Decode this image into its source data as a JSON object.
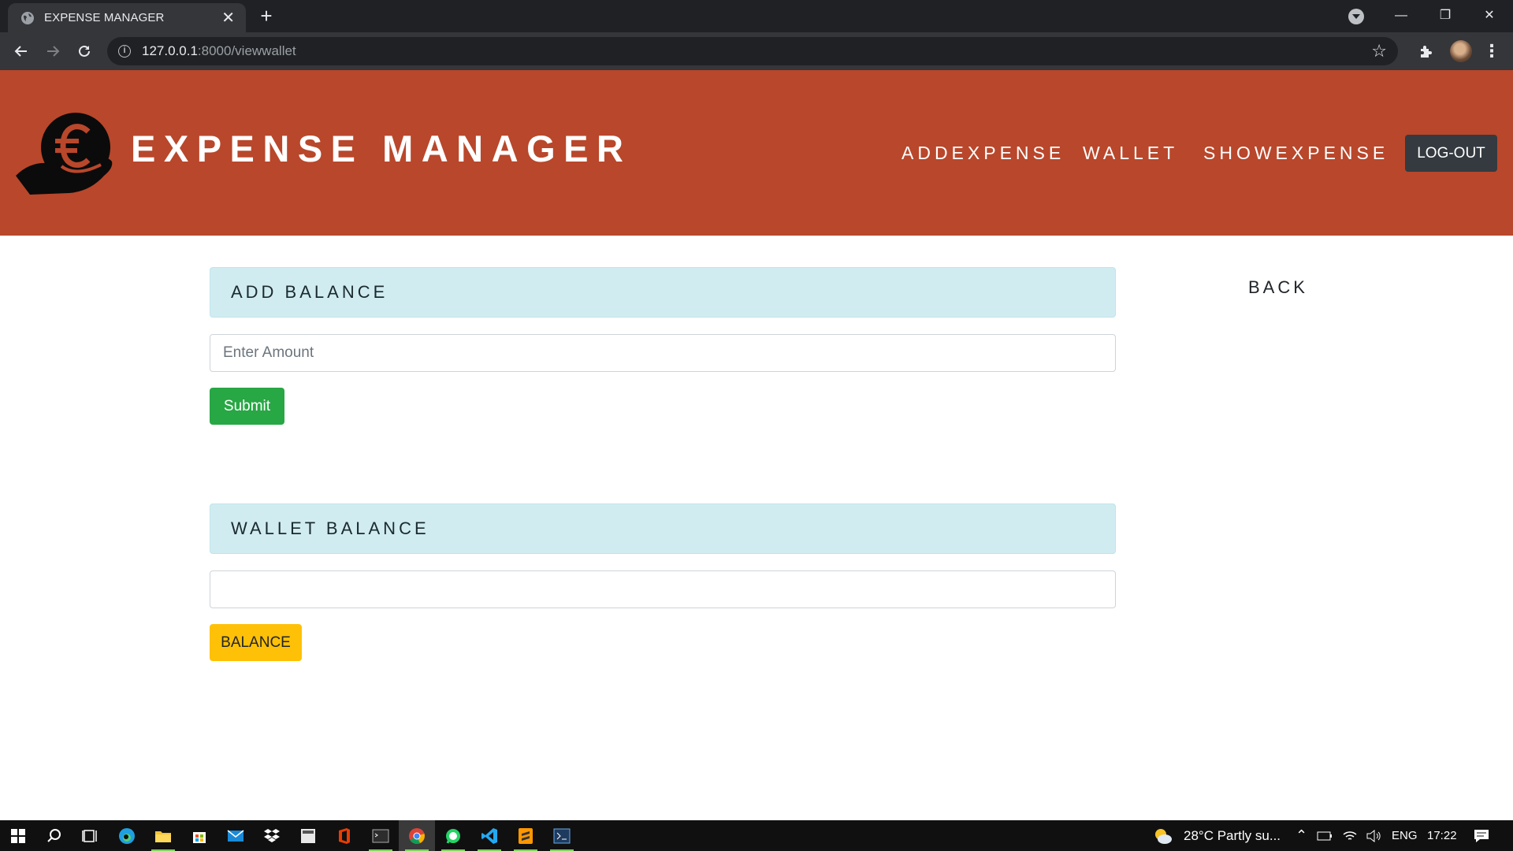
{
  "browser": {
    "tab_title": "EXPENSE MANAGER",
    "tab_close": "✕",
    "new_tab": "+",
    "url_host": "127.0.0.1",
    "url_path": ":8000/viewwallet",
    "window_controls": {
      "minimize": "—",
      "restore": "❐",
      "close": "✕"
    }
  },
  "header": {
    "brand": "EXPENSE MANAGER",
    "nav": [
      "ADDEXPENSE",
      "WALLET",
      "SHOWEXPENSE"
    ],
    "logout": "LOG-OUT"
  },
  "add_balance": {
    "heading": "ADD BALANCE",
    "amount_placeholder": "Enter Amount",
    "amount_value": "",
    "submit": "Submit"
  },
  "wallet_balance": {
    "heading": "WALLET BALANCE",
    "balance_value": "",
    "balance_button": "BALANCE"
  },
  "back_link": "BACK",
  "taskbar": {
    "weather": "28°C  Partly su...",
    "language": "ENG",
    "time": "17:22"
  },
  "colors": {
    "header": "#b9472b",
    "panel": "#d1ecf1",
    "submit": "#28a745",
    "balance": "#ffc107",
    "logout": "#343a40"
  }
}
